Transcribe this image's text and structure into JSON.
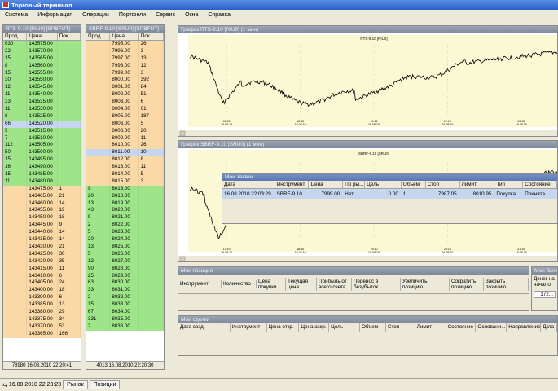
{
  "window": {
    "title": "Торговый терминал"
  },
  "menu": [
    "Система",
    "Информация",
    "Операции",
    "Портфели",
    "Сервис",
    "Окна",
    "Справка"
  ],
  "glass_rts": {
    "title": "RTS-9.10 [RIU0] [SPBFUT]",
    "headers": [
      "Прод.",
      "Цена",
      "Пок."
    ],
    "rows": [
      {
        "sell": "630",
        "price": "143575.00",
        "buy": "",
        "type": "ask"
      },
      {
        "sell": "22",
        "price": "143570.00",
        "buy": "",
        "type": "ask"
      },
      {
        "sell": "15",
        "price": "143565.00",
        "buy": "",
        "type": "ask"
      },
      {
        "sell": "8",
        "price": "143560.00",
        "buy": "",
        "type": "ask"
      },
      {
        "sell": "15",
        "price": "143555.00",
        "buy": "",
        "type": "ask"
      },
      {
        "sell": "30",
        "price": "143550.00",
        "buy": "",
        "type": "ask"
      },
      {
        "sell": "12",
        "price": "143545.00",
        "buy": "",
        "type": "ask"
      },
      {
        "sell": "11",
        "price": "143540.00",
        "buy": "",
        "type": "ask"
      },
      {
        "sell": "33",
        "price": "143535.00",
        "buy": "",
        "type": "ask"
      },
      {
        "sell": "11",
        "price": "143530.00",
        "buy": "",
        "type": "ask"
      },
      {
        "sell": "6",
        "price": "143525.00",
        "buy": "",
        "type": "ask"
      },
      {
        "sell": "66",
        "price": "143520.00",
        "buy": "",
        "type": "hl"
      },
      {
        "sell": "9",
        "price": "143515.00",
        "buy": "",
        "type": "ask"
      },
      {
        "sell": "7",
        "price": "143510.00",
        "buy": "",
        "type": "ask"
      },
      {
        "sell": "112",
        "price": "143505.00",
        "buy": "",
        "type": "ask"
      },
      {
        "sell": "50",
        "price": "143500.00",
        "buy": "",
        "type": "ask"
      },
      {
        "sell": "15",
        "price": "143495.00",
        "buy": "",
        "type": "ask"
      },
      {
        "sell": "16",
        "price": "143490.00",
        "buy": "",
        "type": "ask"
      },
      {
        "sell": "15",
        "price": "143485.00",
        "buy": "",
        "type": "ask"
      },
      {
        "sell": "11",
        "price": "143480.00",
        "buy": "",
        "type": "ask"
      },
      {
        "sell": "",
        "price": "143475.00",
        "buy": "1",
        "type": "bid"
      },
      {
        "sell": "",
        "price": "143465.00",
        "buy": "21",
        "type": "bid"
      },
      {
        "sell": "",
        "price": "143460.00",
        "buy": "14",
        "type": "bid"
      },
      {
        "sell": "",
        "price": "143455.00",
        "buy": "19",
        "type": "bid"
      },
      {
        "sell": "",
        "price": "143450.00",
        "buy": "18",
        "type": "bid"
      },
      {
        "sell": "",
        "price": "143445.00",
        "buy": "9",
        "type": "bid"
      },
      {
        "sell": "",
        "price": "143440.00",
        "buy": "14",
        "type": "bid"
      },
      {
        "sell": "",
        "price": "143435.00",
        "buy": "14",
        "type": "bid"
      },
      {
        "sell": "",
        "price": "143430.00",
        "buy": "21",
        "type": "bid"
      },
      {
        "sell": "",
        "price": "143425.00",
        "buy": "30",
        "type": "bid"
      },
      {
        "sell": "",
        "price": "143420.00",
        "buy": "35",
        "type": "bid"
      },
      {
        "sell": "",
        "price": "143415.00",
        "buy": "11",
        "type": "bid"
      },
      {
        "sell": "",
        "price": "143410.00",
        "buy": "6",
        "type": "bid"
      },
      {
        "sell": "",
        "price": "143405.00",
        "buy": "24",
        "type": "bid"
      },
      {
        "sell": "",
        "price": "143400.00",
        "buy": "18",
        "type": "bid"
      },
      {
        "sell": "",
        "price": "143390.00",
        "buy": "6",
        "type": "bid"
      },
      {
        "sell": "",
        "price": "143385.00",
        "buy": "13",
        "type": "bid"
      },
      {
        "sell": "",
        "price": "143380.00",
        "buy": "29",
        "type": "bid"
      },
      {
        "sell": "",
        "price": "143375.00",
        "buy": "34",
        "type": "bid"
      },
      {
        "sell": "",
        "price": "143370.00",
        "buy": "53",
        "type": "bid"
      },
      {
        "sell": "",
        "price": "143365.00",
        "buy": "166",
        "type": "bid"
      }
    ],
    "footer": "78980 16.08.2010 22:20:41"
  },
  "glass_sbrf": {
    "title": "SBRF-9.10 [SRU0] [SPBFUT]",
    "headers": [
      "Прод.",
      "Цена",
      "Пок."
    ],
    "rows": [
      {
        "sell": "",
        "price": "7995.00",
        "buy": "26",
        "type": "bid"
      },
      {
        "sell": "",
        "price": "7996.00",
        "buy": "3",
        "type": "bid"
      },
      {
        "sell": "",
        "price": "7997.00",
        "buy": "13",
        "type": "bid"
      },
      {
        "sell": "",
        "price": "7998.00",
        "buy": "12",
        "type": "bid"
      },
      {
        "sell": "",
        "price": "7999.00",
        "buy": "3",
        "type": "bid"
      },
      {
        "sell": "",
        "price": "8000.00",
        "buy": "392",
        "type": "bid"
      },
      {
        "sell": "",
        "price": "8001.00",
        "buy": "84",
        "type": "bid"
      },
      {
        "sell": "",
        "price": "8002.00",
        "buy": "51",
        "type": "bid"
      },
      {
        "sell": "",
        "price": "8003.00",
        "buy": "6",
        "type": "bid"
      },
      {
        "sell": "",
        "price": "8004.00",
        "buy": "61",
        "type": "bid"
      },
      {
        "sell": "",
        "price": "8005.00",
        "buy": "187",
        "type": "bid"
      },
      {
        "sell": "",
        "price": "8006.00",
        "buy": "5",
        "type": "bid"
      },
      {
        "sell": "",
        "price": "8008.00",
        "buy": "20",
        "type": "bid"
      },
      {
        "sell": "",
        "price": "8009.00",
        "buy": "11",
        "type": "bid"
      },
      {
        "sell": "",
        "price": "8010.00",
        "buy": "26",
        "type": "bid"
      },
      {
        "sell": "",
        "price": "8011.00",
        "buy": "10",
        "type": "hl"
      },
      {
        "sell": "",
        "price": "8012.00",
        "buy": "8",
        "type": "bid"
      },
      {
        "sell": "",
        "price": "8013.00",
        "buy": "11",
        "type": "bid"
      },
      {
        "sell": "",
        "price": "8014.00",
        "buy": "5",
        "type": "bid"
      },
      {
        "sell": "",
        "price": "8015.00",
        "buy": "3",
        "type": "bid"
      },
      {
        "sell": "9",
        "price": "8016.00",
        "buy": "",
        "type": "ask"
      },
      {
        "sell": "20",
        "price": "8018.00",
        "buy": "",
        "type": "ask"
      },
      {
        "sell": "13",
        "price": "8019.00",
        "buy": "",
        "type": "ask"
      },
      {
        "sell": "43",
        "price": "8020.00",
        "buy": "",
        "type": "ask"
      },
      {
        "sell": "9",
        "price": "8021.00",
        "buy": "",
        "type": "ask"
      },
      {
        "sell": "2",
        "price": "8022.00",
        "buy": "",
        "type": "ask"
      },
      {
        "sell": "5",
        "price": "8023.00",
        "buy": "",
        "type": "ask"
      },
      {
        "sell": "20",
        "price": "8024.00",
        "buy": "",
        "type": "ask"
      },
      {
        "sell": "13",
        "price": "8025.00",
        "buy": "",
        "type": "ask"
      },
      {
        "sell": "5",
        "price": "8026.00",
        "buy": "",
        "type": "ask"
      },
      {
        "sell": "12",
        "price": "8027.00",
        "buy": "",
        "type": "ask"
      },
      {
        "sell": "90",
        "price": "8028.00",
        "buy": "",
        "type": "ask"
      },
      {
        "sell": "25",
        "price": "8029.00",
        "buy": "",
        "type": "ask"
      },
      {
        "sell": "63",
        "price": "8030.00",
        "buy": "",
        "type": "ask"
      },
      {
        "sell": "33",
        "price": "8031.00",
        "buy": "",
        "type": "ask"
      },
      {
        "sell": "2",
        "price": "8032.00",
        "buy": "",
        "type": "ask"
      },
      {
        "sell": "15",
        "price": "8033.00",
        "buy": "",
        "type": "ask"
      },
      {
        "sell": "67",
        "price": "8034.00",
        "buy": "",
        "type": "ask"
      },
      {
        "sell": "331",
        "price": "8035.00",
        "buy": "",
        "type": "ask"
      },
      {
        "sell": "2",
        "price": "8036.00",
        "buy": "",
        "type": "ask"
      }
    ],
    "footer": "4013 16.08.2010 22:20:30"
  },
  "chart_rts": {
    "title": "График RTS-9.10 [RIU0] (1 мин)",
    "inner_title": "RTS-9.10 [RIU0]",
    "x_ticks": [
      "11:12\n16.08.10",
      "13:12\n16.08.10",
      "15:12\n16.08.10",
      "17:12\n16.08.10",
      "19:12\n16.08.10"
    ]
  },
  "chart_sbrf": {
    "title": "График SBRF-9.10 [SRU0] (1 мин)",
    "inner_title": "SBRF-9.10 [SRU0]",
    "x_ticks": [
      "17:10\n16.08.10",
      "18:10\n16.08.10",
      "19:10\n16.08.10",
      "20:10\n16.08.10",
      "21:10\n16.08.10"
    ]
  },
  "orders": {
    "title": "Мои заявки",
    "headers": [
      "Дата",
      "Инструмент",
      "Цена",
      "По ры...",
      "Цель",
      "Объем",
      "Стоп",
      "Лимит",
      "Тип",
      "Состояние"
    ],
    "row": [
      "16.08.2010 22:03:29",
      "SBRF-9.10",
      "7999.00",
      "Нет",
      "0.00",
      "1",
      "7987.05",
      "8010.95",
      "Покупка...",
      "Принята"
    ]
  },
  "positions": {
    "title": "Мои позиции",
    "headers": [
      "Инструмент",
      "Количество",
      "Цена покупки",
      "Текущая цена",
      "Прибыль от всего счета",
      "Перенос в безубыток",
      "Увеличить позицию",
      "Сократить позицию",
      "Закрыть позицию"
    ]
  },
  "balance": {
    "title": "Мои балан...",
    "label": "Денег на начало",
    "value": "172..."
  },
  "trades": {
    "title": "Мои сделки",
    "headers": [
      "Дата созд.",
      "Инструмент",
      "Цена откр.",
      "Цена закр.",
      "Цель",
      "Объем",
      "Стоп",
      "Лимит",
      "Состояние",
      "Основани...",
      "Направление",
      "Дата з..."
    ]
  },
  "status": {
    "time": "16.08.2010 22:23:23",
    "tabs": [
      "Рынок",
      "Позиции"
    ]
  },
  "colors": {
    "ask": "#9ee58a",
    "bid": "#fbd9a6",
    "highlight": "#c6d6ee",
    "chart_bg": "#fbf8d4"
  }
}
